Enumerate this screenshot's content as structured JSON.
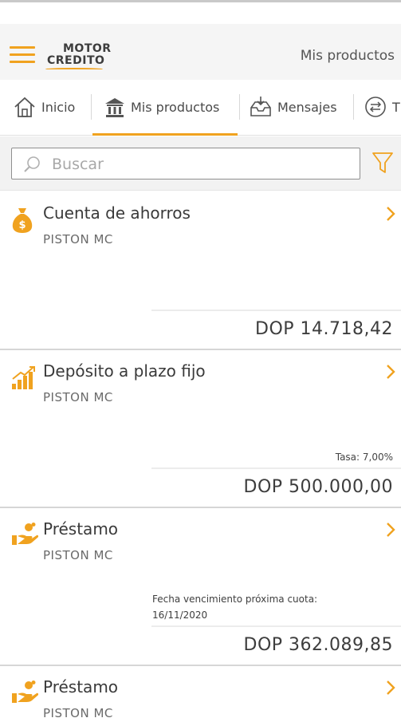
{
  "header": {
    "logo_line1": "MOTOR",
    "logo_line2": "CREDITO",
    "title": "Mis productos",
    "menu_icon": "hamburger-menu-icon",
    "accent_color": "#f0a21f"
  },
  "tabs": [
    {
      "label": "Inicio",
      "icon": "home-icon",
      "active": false
    },
    {
      "label": "Mis productos",
      "icon": "bank-icon",
      "active": true
    },
    {
      "label": "Mensajes",
      "icon": "inbox-icon",
      "active": false
    },
    {
      "label": "T",
      "icon": "transfer-icon",
      "active": false
    }
  ],
  "search": {
    "placeholder": "Buscar",
    "value": "",
    "search_icon": "search-icon",
    "filter_icon": "filter-icon"
  },
  "products": [
    {
      "title": "Cuenta de ahorros",
      "owner": "PISTON MC",
      "icon": "money-bag-icon",
      "amount": "DOP 14.718,42"
    },
    {
      "title": "Depósito a plazo fijo",
      "owner": "PISTON MC",
      "icon": "growth-chart-icon",
      "rate": "Tasa: 7,00%",
      "amount": "DOP 500.000,00"
    },
    {
      "title": "Préstamo",
      "owner": "PISTON MC",
      "icon": "loan-hand-icon",
      "note_label": "Fecha vencimiento próxima cuota:",
      "note_value": "16/11/2020",
      "amount": "DOP 362.089,85"
    },
    {
      "title": "Préstamo",
      "owner": "PISTON MC",
      "icon": "loan-hand-icon"
    }
  ]
}
